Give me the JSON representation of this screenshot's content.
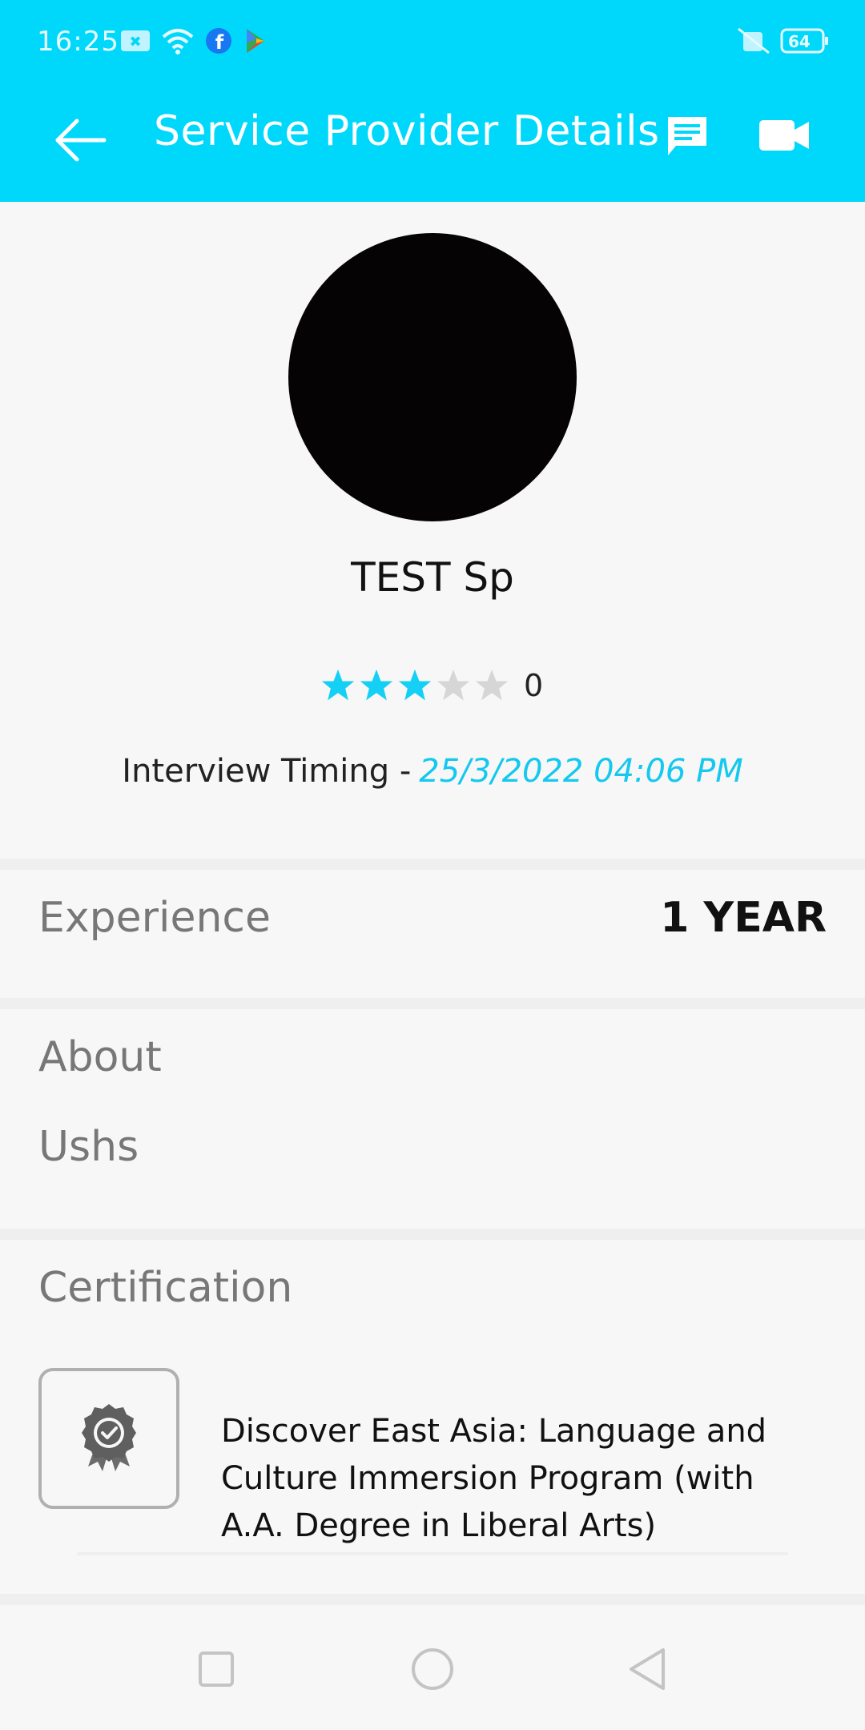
{
  "status_bar": {
    "time": "16:25",
    "battery": "64",
    "icons": [
      "app-notification-icon",
      "wifi-icon",
      "facebook-icon",
      "play-store-icon",
      "vibrate-mute-icon",
      "battery-icon"
    ]
  },
  "app_bar": {
    "title": "Service Provider Details",
    "icons": [
      "back-arrow-icon",
      "chat-icon",
      "video-call-icon"
    ],
    "background_color": "#00d8fb"
  },
  "profile": {
    "name": "TEST Sp",
    "rating_count": "0",
    "stars_filled": 3,
    "stars_total": 5,
    "interview_label": "Interview Timing -",
    "interview_value": "25/3/2022  04:06 PM",
    "accent_color": "#14c8ef"
  },
  "experience": {
    "label": "Experience",
    "value": "1 YEAR"
  },
  "about": {
    "label": "About",
    "text": "Ushs"
  },
  "certification": {
    "label": "Certification",
    "items": [
      {
        "title": "Discover East Asia: Language and Culture Immersion Program (with A.A. Degree in Liberal Arts)",
        "icon": "certificate-badge-icon"
      }
    ]
  },
  "nav_bar": {
    "icons": [
      "recent-apps-icon",
      "home-icon",
      "back-icon"
    ]
  }
}
